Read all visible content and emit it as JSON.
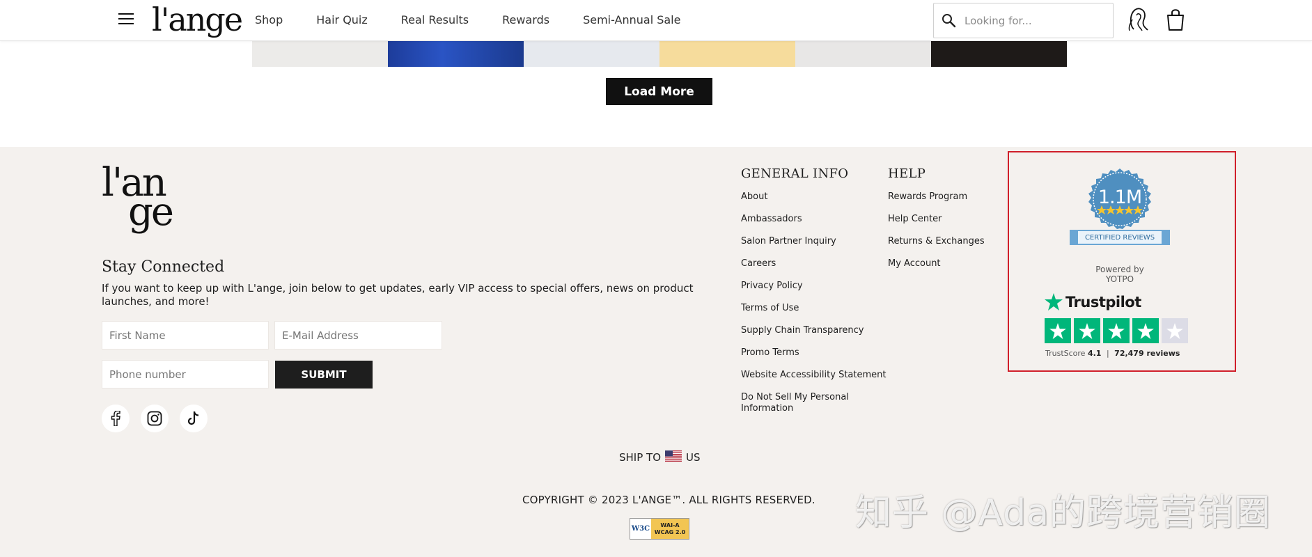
{
  "header": {
    "logo": "l'ange",
    "nav": [
      "Shop",
      "Hair Quiz",
      "Real Results",
      "Rewards",
      "Semi-Annual Sale"
    ],
    "search_placeholder": "Looking for..."
  },
  "main": {
    "load_more_label": "Load More"
  },
  "footer": {
    "logo_line1": "l'an",
    "logo_line2": "ge",
    "stay_title": "Stay Connected",
    "stay_text": "If you want to keep up with L'ange, join below to get updates, early VIP access to special offers, news on product launches, and more!",
    "first_name_placeholder": "First Name",
    "email_placeholder": "E-Mail Address",
    "phone_placeholder": "Phone number",
    "submit_label": "SUBMIT",
    "general_info": {
      "title": "GENERAL INFO",
      "items": [
        "About",
        "Ambassadors",
        "Salon Partner Inquiry",
        "Careers",
        "Privacy Policy",
        "Terms of Use",
        "Supply Chain Transparency",
        "Promo Terms",
        "Website Accessibility Statement",
        "Do Not Sell My Personal Information"
      ]
    },
    "help": {
      "title": "HELP",
      "items": [
        "Rewards Program",
        "Help Center",
        "Returns & Exchanges",
        "My Account"
      ]
    },
    "yotpo": {
      "count": "1.1M",
      "label": "CERTIFIED REVIEWS",
      "powered": "Powered by YOTPO"
    },
    "trustpilot": {
      "name": "Trustpilot",
      "score_label": "TrustScore",
      "score": "4.1",
      "reviews": "72,479 reviews",
      "rating": 4
    },
    "ship_label": "SHIP TO",
    "ship_country": "US",
    "copyright": "COPYRIGHT © 2023 L'ANGE™. ALL RIGHTS RESERVED.",
    "w3c": {
      "mark": "W3C",
      "level": "WAI-A",
      "version": "WCAG 2.0"
    }
  },
  "watermark": "知乎 @Ada的跨境营销圈",
  "colors": {
    "footer_bg": "#f4f1ee",
    "highlight": "#d01f2a",
    "trustpilot_green": "#00b67a",
    "yotpo_blue": "#4a90c2"
  }
}
